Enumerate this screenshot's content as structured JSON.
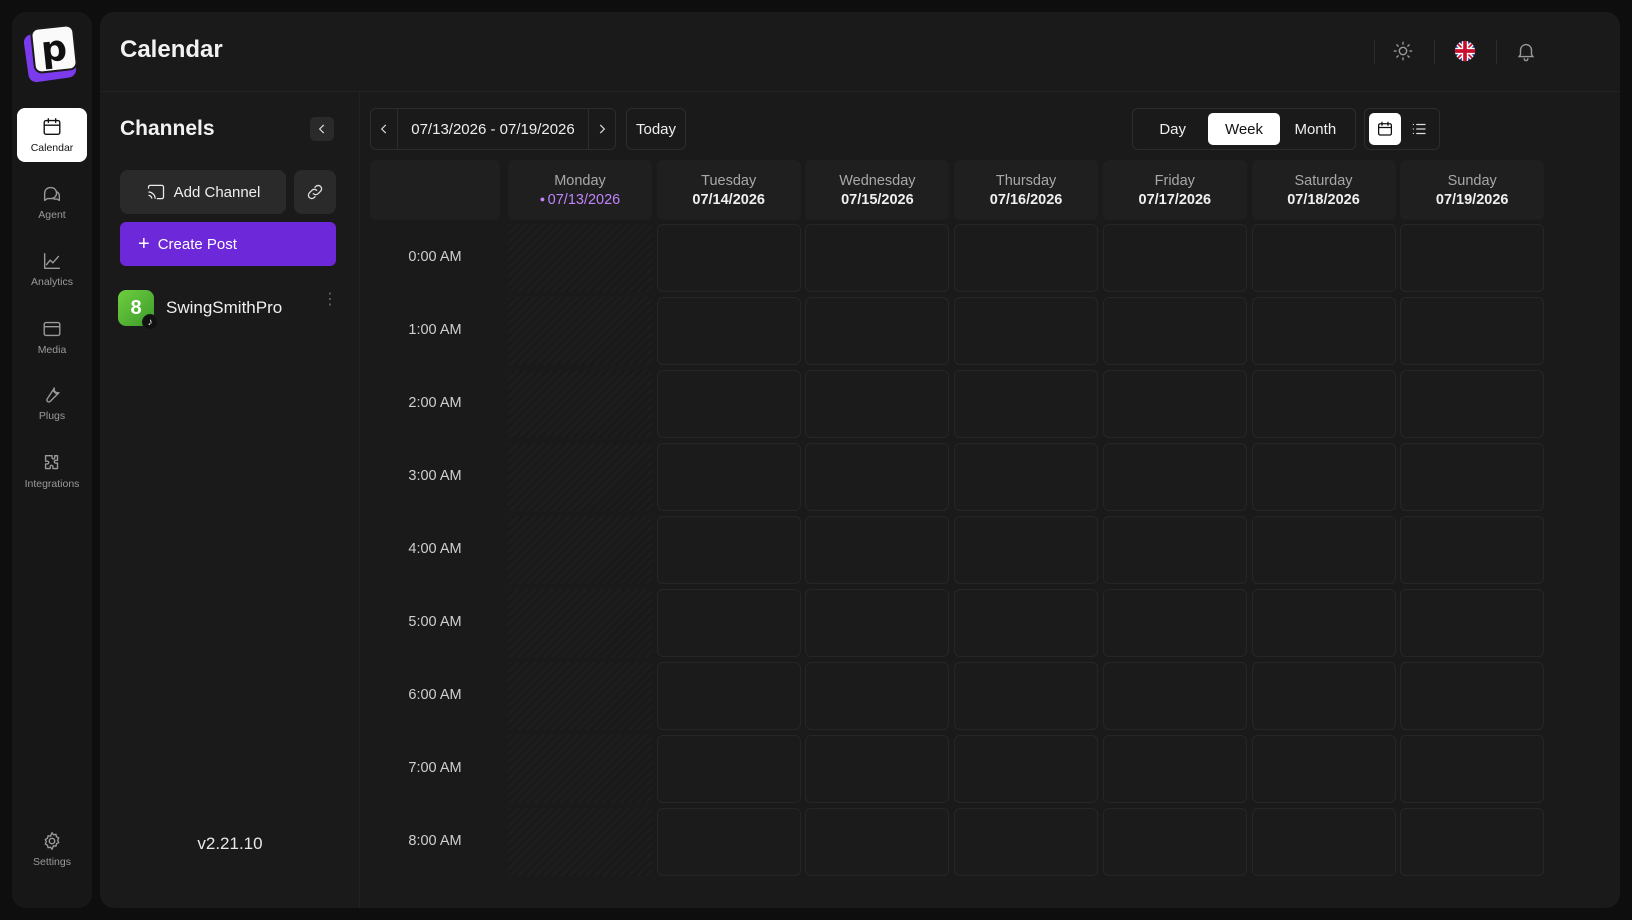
{
  "nav": {
    "items": [
      {
        "label": "Calendar",
        "icon": "calendar-icon",
        "active": true
      },
      {
        "label": "Agent",
        "icon": "chat-icon",
        "active": false
      },
      {
        "label": "Analytics",
        "icon": "chart-icon",
        "active": false
      },
      {
        "label": "Media",
        "icon": "media-icon",
        "active": false
      },
      {
        "label": "Plugs",
        "icon": "wrench-icon",
        "active": false
      },
      {
        "label": "Integrations",
        "icon": "puzzle-icon",
        "active": false
      }
    ],
    "settings": {
      "label": "Settings",
      "icon": "gear-icon"
    }
  },
  "header": {
    "title": "Calendar",
    "icons": [
      "sun-icon",
      "uk-flag-icon",
      "bell-icon"
    ]
  },
  "channels": {
    "title": "Channels",
    "add_channel_label": "Add Channel",
    "create_post_label": "Create Post",
    "items": [
      {
        "name": "SwingSmithPro",
        "platform": "tiktok"
      }
    ],
    "version": "v2.21.10"
  },
  "calendar": {
    "date_range": "07/13/2026 - 07/19/2026",
    "today_label": "Today",
    "views": [
      "Day",
      "Week",
      "Month"
    ],
    "active_view": "Week",
    "days": [
      {
        "name": "Monday",
        "date": "07/13/2026",
        "today": true
      },
      {
        "name": "Tuesday",
        "date": "07/14/2026",
        "today": false
      },
      {
        "name": "Wednesday",
        "date": "07/15/2026",
        "today": false
      },
      {
        "name": "Thursday",
        "date": "07/16/2026",
        "today": false
      },
      {
        "name": "Friday",
        "date": "07/17/2026",
        "today": false
      },
      {
        "name": "Saturday",
        "date": "07/18/2026",
        "today": false
      },
      {
        "name": "Sunday",
        "date": "07/19/2026",
        "today": false
      }
    ],
    "hours": [
      "0:00 AM",
      "1:00 AM",
      "2:00 AM",
      "3:00 AM",
      "4:00 AM",
      "5:00 AM",
      "6:00 AM",
      "7:00 AM",
      "8:00 AM"
    ]
  },
  "colors": {
    "accent": "#6d28d9",
    "today_text": "#c084fc",
    "background": "#1a1a1a"
  }
}
